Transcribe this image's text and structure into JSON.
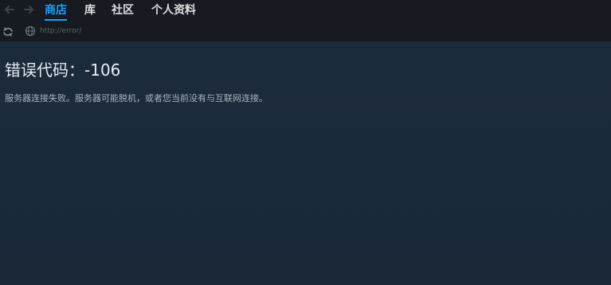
{
  "nav": {
    "back_icon": "arrow-left-icon",
    "forward_icon": "arrow-right-icon",
    "tabs": [
      {
        "label": "商店",
        "active": true
      },
      {
        "label": "库",
        "active": false
      },
      {
        "label": "社区",
        "active": false
      },
      {
        "label": "个人资料",
        "active": false
      }
    ],
    "active_color": "#1a9fff"
  },
  "urlbar": {
    "reload_icon": "reload-icon",
    "globe_icon": "globe-icon",
    "url": "http://error/"
  },
  "error": {
    "title": "错误代码：-106",
    "message": "服务器连接失败。服务器可能脱机，或者您当前没有与互联网连接。"
  },
  "colors": {
    "nav_background": "#171a21",
    "content_background": "#1b2838"
  }
}
